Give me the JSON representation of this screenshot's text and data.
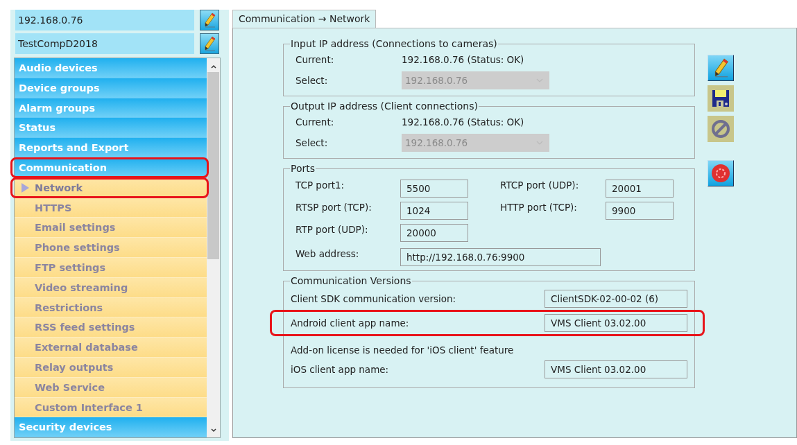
{
  "hosts": [
    {
      "value": "192.168.0.76"
    },
    {
      "value": "TestCompD2018"
    }
  ],
  "menu": [
    {
      "label": "Audio devices",
      "kind": "category",
      "selected": false,
      "highlighted": false
    },
    {
      "label": "Device groups",
      "kind": "category",
      "selected": false,
      "highlighted": false
    },
    {
      "label": "Alarm groups",
      "kind": "category",
      "selected": false,
      "highlighted": false
    },
    {
      "label": "Status",
      "kind": "category",
      "selected": false,
      "highlighted": false
    },
    {
      "label": "Reports and Export",
      "kind": "category",
      "selected": false,
      "highlighted": false
    },
    {
      "label": "Communication",
      "kind": "category",
      "selected": false,
      "highlighted": true
    },
    {
      "label": "Network",
      "kind": "subitem",
      "selected": true,
      "highlighted": true
    },
    {
      "label": "HTTPS",
      "kind": "subitem",
      "selected": false,
      "highlighted": false
    },
    {
      "label": "Email settings",
      "kind": "subitem",
      "selected": false,
      "highlighted": false
    },
    {
      "label": "Phone settings",
      "kind": "subitem",
      "selected": false,
      "highlighted": false
    },
    {
      "label": "FTP settings",
      "kind": "subitem",
      "selected": false,
      "highlighted": false
    },
    {
      "label": "Video streaming",
      "kind": "subitem",
      "selected": false,
      "highlighted": false
    },
    {
      "label": "Restrictions",
      "kind": "subitem",
      "selected": false,
      "highlighted": false
    },
    {
      "label": "RSS feed settings",
      "kind": "subitem",
      "selected": false,
      "highlighted": false
    },
    {
      "label": "External database",
      "kind": "subitem",
      "selected": false,
      "highlighted": false
    },
    {
      "label": "Relay outputs",
      "kind": "subitem",
      "selected": false,
      "highlighted": false
    },
    {
      "label": "Web Service",
      "kind": "subitem",
      "selected": false,
      "highlighted": false
    },
    {
      "label": "Custom Interface 1",
      "kind": "subitem",
      "selected": false,
      "highlighted": false
    },
    {
      "label": "Security devices",
      "kind": "category",
      "selected": false,
      "highlighted": false
    }
  ],
  "tab": {
    "label": "Communication → Network",
    "selected": true
  },
  "ip_groups": [
    {
      "title": "Input IP address (Connections to cameras)",
      "current_label": "Current:",
      "current_value": "192.168.0.76 (Status: OK)",
      "select_label": "Select:",
      "select_value": "192.168.0.76",
      "disabled": true
    },
    {
      "title": "Output IP address (Client connections)",
      "current_label": "Current:",
      "current_value": "192.168.0.76 (Status: OK)",
      "select_label": "Select:",
      "select_value": "192.168.0.76",
      "disabled": true
    }
  ],
  "ports": {
    "title": "Ports",
    "fields": [
      {
        "label": "TCP port1:",
        "value": "5500"
      },
      {
        "label": "RTCP port (UDP):",
        "value": "20001"
      },
      {
        "label": "RTSP port (TCP):",
        "value": "1024"
      },
      {
        "label": "HTTP port (TCP):",
        "value": "9900"
      },
      {
        "label": "RTP port (UDP):",
        "value": "20000"
      }
    ],
    "web": {
      "label": "Web address:",
      "value": "http://192.168.0.76:9900"
    }
  },
  "versions": {
    "title": "Communication Versions",
    "rows": [
      {
        "kind": "field",
        "label": "Client SDK communication version:",
        "value": "ClientSDK-02-00-02 (6)",
        "highlighted": false
      },
      {
        "kind": "field",
        "label": "Android client app name:",
        "value": "VMS Client 03.02.00",
        "highlighted": true
      },
      {
        "kind": "note",
        "text": "Add-on license is needed for 'iOS client' feature"
      },
      {
        "kind": "field",
        "label": "iOS client app name:",
        "value": "VMS Client 03.02.00",
        "highlighted": false
      }
    ]
  },
  "actions": [
    {
      "kind": "edit",
      "disabled": false
    },
    {
      "kind": "save",
      "disabled": true
    },
    {
      "kind": "cancel",
      "disabled": true
    },
    {
      "kind": "reset",
      "disabled": false
    }
  ]
}
